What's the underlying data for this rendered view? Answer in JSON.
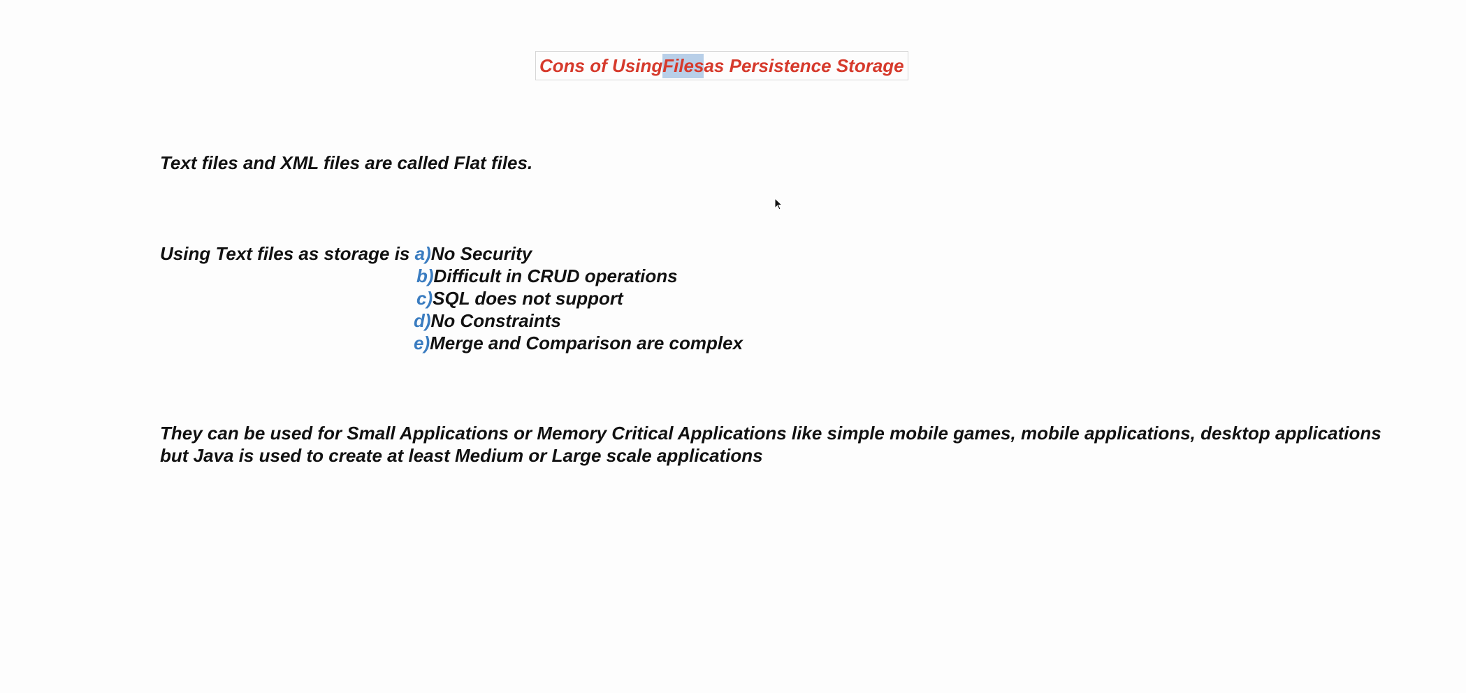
{
  "slide": {
    "title": {
      "before": "Cons of Using ",
      "selected": "Files",
      "after": " as Persistence Storage",
      "color": "#d63a2c",
      "selection_color": "#b8cfe8"
    },
    "flat_files_statement": "Text files and XML files are called Flat files.",
    "cons_intro": "Using Text files as storage is ",
    "cons": [
      {
        "marker": "a)",
        "text": "No Security"
      },
      {
        "marker": "b)",
        "text": "Difficult in CRUD operations"
      },
      {
        "marker": "c)",
        "text": "SQL does not support"
      },
      {
        "marker": "d)",
        "text": "No Constraints"
      },
      {
        "marker": "e)",
        "text": "Merge and Comparison are complex"
      }
    ],
    "marker_color": "#3a7cc0",
    "usage_note": {
      "line1": "They can be used for Small Applications or Memory Critical Applications like simple mobile games, mobile applications, desktop applications",
      "line2": "but Java is used to create at least Medium or Large scale applications"
    }
  },
  "cursor": {
    "icon": "mouse-pointer-icon"
  }
}
